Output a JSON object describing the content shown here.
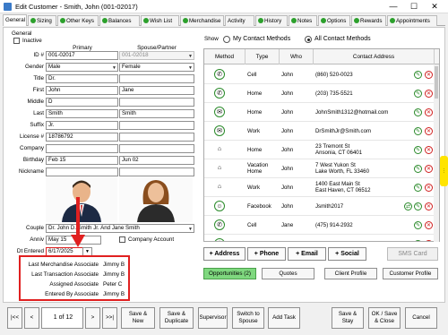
{
  "window": {
    "title": "Edit Customer - Smith, John (001-02017)",
    "min": "—",
    "max": "☐",
    "close": "✕"
  },
  "tabs": [
    "General",
    "Sizing",
    "Other Keys",
    "Balances",
    "Wish List",
    "Merchandise",
    "Activity",
    "History",
    "Notes",
    "Options",
    "Rewards",
    "Appointments"
  ],
  "general": {
    "section": "General",
    "inactive_label": "Inactive",
    "primary_header": "Primary",
    "spouse_header": "Spouse/Partner",
    "fields": [
      {
        "label": "ID #",
        "primary": "001-02017",
        "spouse": "001-02018"
      },
      {
        "label": "Gender",
        "primary": "Male",
        "spouse": "Female"
      },
      {
        "label": "Title",
        "primary": "Dr.",
        "spouse": ""
      },
      {
        "label": "First",
        "primary": "John",
        "spouse": "Jane"
      },
      {
        "label": "Middle",
        "primary": "D",
        "spouse": ""
      },
      {
        "label": "Last",
        "primary": "Smith",
        "spouse": "Smith"
      },
      {
        "label": "Suffix",
        "primary": "Jr.",
        "spouse": ""
      },
      {
        "label": "License #",
        "primary": "18786792",
        "spouse": ""
      },
      {
        "label": "Company",
        "primary": "",
        "spouse": ""
      },
      {
        "label": "Birthday",
        "primary": "Feb 15",
        "spouse": "Jun 02"
      },
      {
        "label": "Nickname",
        "primary": "",
        "spouse": ""
      }
    ],
    "couple_label": "Couple",
    "couple_value": "Dr. John D. Smith Jr. And Jane Smith",
    "anniv_label": "Anniv",
    "anniv_value": "May 15",
    "company_account_label": "Company Account",
    "dt_entered_label": "Dt Entered",
    "dt_entered_value": "6/17/2025",
    "associates": [
      {
        "label": "Last Merchandise Associate",
        "value": "Jimmy B"
      },
      {
        "label": "Last Transaction Associate",
        "value": "Jimmy B"
      },
      {
        "label": "Assigned Associate",
        "value": "Peter C"
      },
      {
        "label": "Entered By Associate",
        "value": "Jimmy B"
      }
    ]
  },
  "contacts": {
    "show_label": "Show",
    "my_methods": "My Contact Methods",
    "all_methods": "All Contact Methods",
    "columns": [
      "Method",
      "Type",
      "Who",
      "Contact Address"
    ],
    "rows": [
      {
        "icon": "✆",
        "type": "Cell",
        "who": "John",
        "address": "(860) 520-0023",
        "extra": false
      },
      {
        "icon": "✆",
        "type": "Home",
        "who": "John",
        "address": "(203) 735-5521",
        "extra": false
      },
      {
        "icon": "✉",
        "type": "Home",
        "who": "John",
        "address": "JohnSmith1312@hotmail.com",
        "extra": false
      },
      {
        "icon": "✉",
        "type": "Work",
        "who": "John",
        "address": "DrSmithJr@Smith.com",
        "extra": false
      },
      {
        "icon": "⌂",
        "type": "Home",
        "who": "John",
        "address": "23 Tremont St\nAnsonia, CT 06401",
        "extra": false
      },
      {
        "icon": "⌂",
        "type": "Vacation\nHome",
        "who": "John",
        "address": "7 West Yukon St\nLake Worth, FL 33460",
        "extra": false
      },
      {
        "icon": "⌂",
        "type": "Work",
        "who": "John",
        "address": "1400 East Main St\nEast Haven, CT 06512",
        "extra": false
      },
      {
        "icon": "☺",
        "type": "Facebook",
        "who": "John",
        "address": "Jsmith2017",
        "extra": true
      },
      {
        "icon": "✆",
        "type": "Cell",
        "who": "Jane",
        "address": "(475) 914-2932",
        "extra": false
      },
      {
        "icon": "✆",
        "type": "Home",
        "who": "Jane",
        "address": "(203) 735-5521",
        "extra": false
      },
      {
        "icon": "✉",
        "type": "Home",
        "who": "Jane",
        "address": "JSmith_21@yahoo.com",
        "extra": false
      }
    ],
    "buttons": {
      "address": "+ Address",
      "phone": "+ Phone",
      "email": "+ Email",
      "social": "+ Social",
      "sms": "SMS Card"
    },
    "links": {
      "opportunities": "Opportunities (2)",
      "quotes": "Quotes",
      "client_profile": "Client Profile",
      "customer_profile": "Customer Profile"
    }
  },
  "footer": {
    "first": "|<<",
    "prev": "<",
    "record": "1 of 12",
    "next": ">",
    "last": ">>|",
    "save_new": "Save &\nNew",
    "save_duplicate": "Save &\nDuplicate",
    "supervisor": "Supervisor",
    "switch_spouse": "Switch to\nSpouse",
    "add_task": "Add Task",
    "save_stay": "Save &\nStay",
    "ok_save_close": "OK / Save\n& Close",
    "cancel": "Cancel"
  },
  "colors": {
    "accent_green": "#2ca02c",
    "delete_red": "#d02020",
    "highlight_red": "#e02020",
    "opportunities_green": "#7fd87f",
    "side_tab_yellow": "#ffe400"
  }
}
